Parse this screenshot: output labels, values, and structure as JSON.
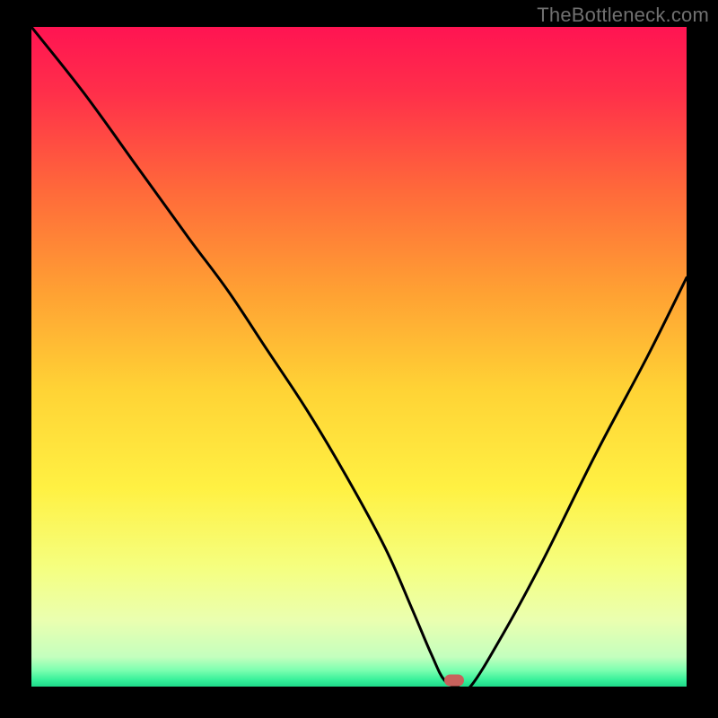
{
  "watermark": "TheBottleneck.com",
  "colors": {
    "frame": "#000000",
    "watermark": "#707070",
    "curve": "#000000",
    "marker": "#c8615c",
    "gradient_stops": [
      {
        "offset": 0.0,
        "color": "#ff1452"
      },
      {
        "offset": 0.1,
        "color": "#ff2f4a"
      },
      {
        "offset": 0.25,
        "color": "#ff6a3a"
      },
      {
        "offset": 0.4,
        "color": "#ffa033"
      },
      {
        "offset": 0.55,
        "color": "#ffd335"
      },
      {
        "offset": 0.7,
        "color": "#fff143"
      },
      {
        "offset": 0.82,
        "color": "#f5ff80"
      },
      {
        "offset": 0.9,
        "color": "#eaffb0"
      },
      {
        "offset": 0.955,
        "color": "#c4ffbe"
      },
      {
        "offset": 0.975,
        "color": "#7dffb0"
      },
      {
        "offset": 0.99,
        "color": "#36f09a"
      },
      {
        "offset": 1.0,
        "color": "#1fd98a"
      }
    ]
  },
  "marker": {
    "x_pct": 64.5,
    "y_pct": 99.0
  },
  "chart_data": {
    "type": "line",
    "title": "",
    "xlabel": "",
    "ylabel": "",
    "xlim": [
      0,
      100
    ],
    "ylim": [
      0,
      100
    ],
    "series": [
      {
        "name": "bottleneck-curve",
        "x": [
          0,
          8,
          16,
          24,
          30,
          36,
          42,
          48,
          54,
          58,
          61,
          63,
          65,
          67,
          72,
          78,
          86,
          94,
          100
        ],
        "y": [
          100,
          90,
          79,
          68,
          60,
          51,
          42,
          32,
          21,
          12,
          5,
          1,
          0,
          0,
          8,
          19,
          35,
          50,
          62
        ]
      }
    ],
    "annotations": [
      {
        "type": "marker",
        "x": 64.5,
        "y": 1.0,
        "label": "optimal-point"
      }
    ]
  }
}
